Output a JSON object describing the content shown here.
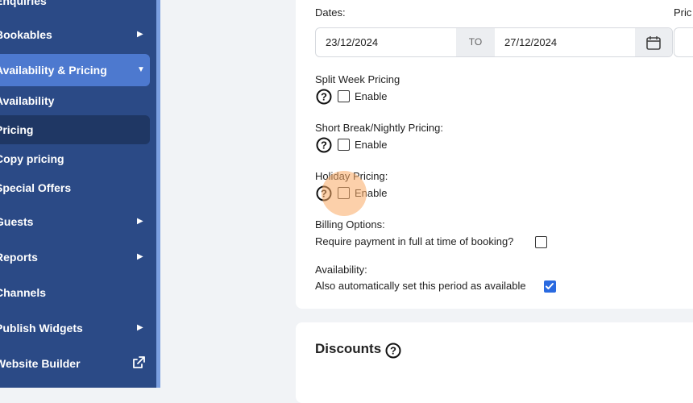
{
  "sidebar": {
    "items": [
      {
        "label": "Enquiries",
        "arrow": ""
      },
      {
        "label": "Bookables",
        "arrow": "▶"
      },
      {
        "label": "Availability & Pricing",
        "arrow": "▼"
      },
      {
        "label": "Availability",
        "arrow": ""
      },
      {
        "label": "Pricing",
        "arrow": ""
      },
      {
        "label": "Copy pricing",
        "arrow": ""
      },
      {
        "label": "Special Offers",
        "arrow": ""
      },
      {
        "label": "Guests",
        "arrow": "▶"
      },
      {
        "label": "Reports",
        "arrow": "▶"
      },
      {
        "label": "Channels",
        "arrow": ""
      },
      {
        "label": "Publish Widgets",
        "arrow": "▶"
      },
      {
        "label": "Website Builder",
        "arrow": ""
      }
    ]
  },
  "form": {
    "dates_label": "Dates:",
    "price_label": "Pric",
    "date_from": "23/12/2024",
    "date_to_label": "TO",
    "date_to": "27/12/2024",
    "split_week": {
      "label": "Split Week Pricing",
      "checkbox_label": "Enable",
      "checked": false
    },
    "short_break": {
      "label": "Short Break/Nightly Pricing:",
      "checkbox_label": "Enable",
      "checked": false
    },
    "holiday": {
      "label": "Holiday Pricing:",
      "checkbox_label": "Enable",
      "checked": false
    },
    "billing": {
      "label": "Billing Options:",
      "option_label": "Require payment in full at time of booking?",
      "checked": false
    },
    "availability": {
      "label": "Availability:",
      "option_label": "Also automatically set this period as available",
      "checked": true
    }
  },
  "discounts": {
    "title": "Discounts"
  },
  "colors": {
    "sidebar": "#2b4a86",
    "active": "#4d79cf",
    "selected": "#1f3764",
    "accent": "#2a6ae0"
  }
}
